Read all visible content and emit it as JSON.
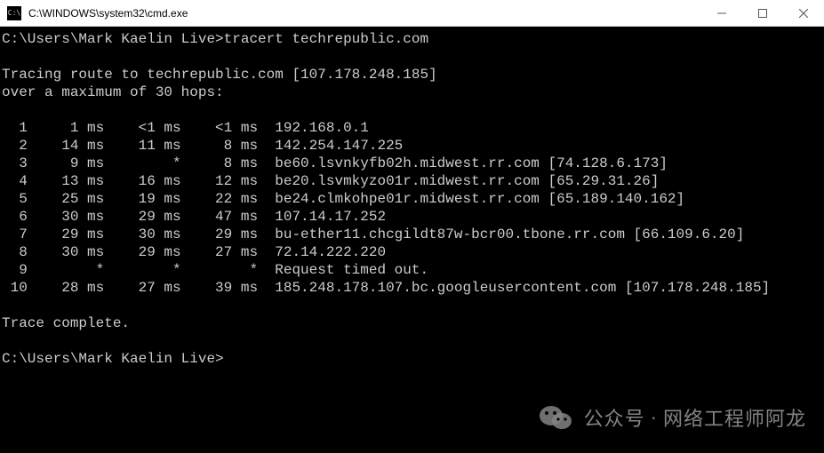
{
  "window": {
    "title_path": "C:\\WINDOWS\\system32\\cmd.exe",
    "icon_glyph": "C:\\"
  },
  "terminal": {
    "prompt1": "C:\\Users\\Mark Kaelin Live>",
    "command": "tracert techrepublic.com",
    "trace_header_line1": "Tracing route to techrepublic.com [107.178.248.185]",
    "trace_header_line2": "over a maximum of 30 hops:",
    "hops": [
      {
        "n": "1",
        "t1": "1 ms",
        "t2": "<1 ms",
        "t3": "<1 ms",
        "dest": "192.168.0.1"
      },
      {
        "n": "2",
        "t1": "14 ms",
        "t2": "11 ms",
        "t3": "8 ms",
        "dest": "142.254.147.225"
      },
      {
        "n": "3",
        "t1": "9 ms",
        "t2": "*",
        "t3": "8 ms",
        "dest": "be60.lsvnkyfb02h.midwest.rr.com [74.128.6.173]"
      },
      {
        "n": "4",
        "t1": "13 ms",
        "t2": "16 ms",
        "t3": "12 ms",
        "dest": "be20.lsvmkyzo01r.midwest.rr.com [65.29.31.26]"
      },
      {
        "n": "5",
        "t1": "25 ms",
        "t2": "19 ms",
        "t3": "22 ms",
        "dest": "be24.clmkohpe01r.midwest.rr.com [65.189.140.162]"
      },
      {
        "n": "6",
        "t1": "30 ms",
        "t2": "29 ms",
        "t3": "47 ms",
        "dest": "107.14.17.252"
      },
      {
        "n": "7",
        "t1": "29 ms",
        "t2": "30 ms",
        "t3": "29 ms",
        "dest": "bu-ether11.chcgildt87w-bcr00.tbone.rr.com [66.109.6.20]"
      },
      {
        "n": "8",
        "t1": "30 ms",
        "t2": "29 ms",
        "t3": "27 ms",
        "dest": "72.14.222.220"
      },
      {
        "n": "9",
        "t1": "*",
        "t2": "*",
        "t3": "*",
        "dest": "Request timed out."
      },
      {
        "n": "10",
        "t1": "28 ms",
        "t2": "27 ms",
        "t3": "39 ms",
        "dest": "185.248.178.107.bc.googleusercontent.com [107.178.248.185]"
      }
    ],
    "trace_complete": "Trace complete.",
    "prompt2": "C:\\Users\\Mark Kaelin Live>"
  },
  "watermark": {
    "label": "公众号",
    "separator": "·",
    "name": "网络工程师阿龙"
  }
}
